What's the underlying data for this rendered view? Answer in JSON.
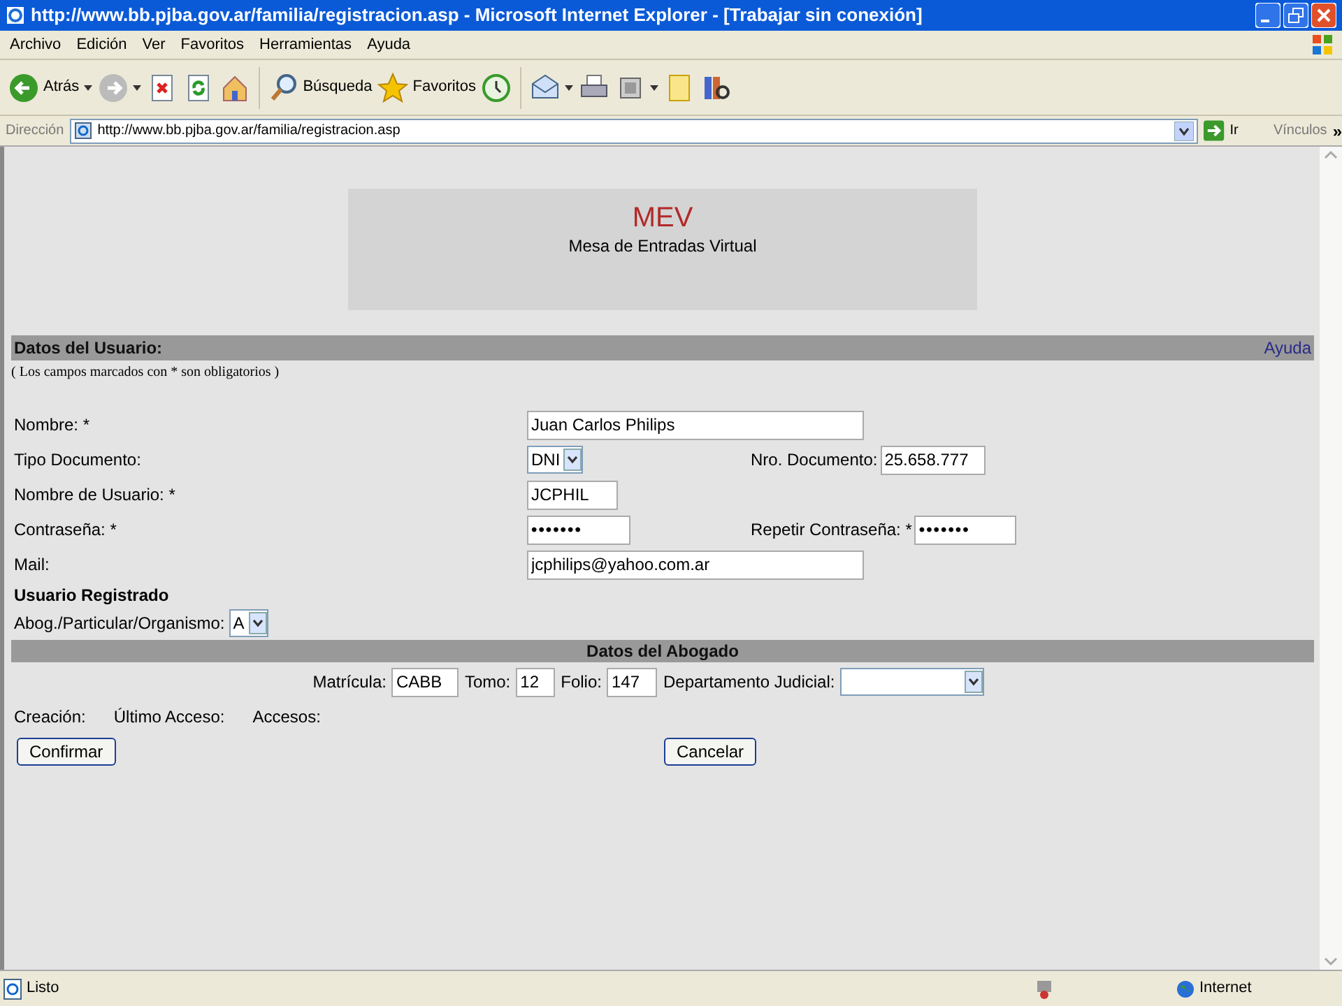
{
  "window": {
    "title": "http://www.bb.pjba.gov.ar/familia/registracion.asp - Microsoft Internet Explorer - [Trabajar sin conexión]"
  },
  "menu": [
    "Archivo",
    "Edición",
    "Ver",
    "Favoritos",
    "Herramientas",
    "Ayuda"
  ],
  "toolbar": [
    {
      "kind": "back",
      "label": "Atrás"
    },
    {
      "kind": "forward"
    },
    {
      "kind": "stop"
    },
    {
      "kind": "refresh"
    },
    {
      "kind": "home"
    },
    {
      "kind": "search",
      "label": "Búsqueda"
    },
    {
      "kind": "favorites",
      "label": "Favoritos"
    },
    {
      "kind": "history"
    },
    {
      "kind": "mail"
    },
    {
      "kind": "print"
    },
    {
      "kind": "edit"
    },
    {
      "kind": "notes"
    },
    {
      "kind": "research"
    }
  ],
  "address": {
    "label": "Dirección",
    "url": "http://www.bb.pjba.gov.ar/familia/registracion.asp",
    "go": "Ir",
    "links": "Vínculos",
    "more": "»"
  },
  "header": {
    "title": "MEV",
    "subtitle": "Mesa de Entradas Virtual"
  },
  "user_section": {
    "title": "Datos del Usuario:",
    "help": "Ayuda",
    "note": "( Los campos marcados con * son obligatorios )"
  },
  "user_fields": [
    {
      "label": "Nombre: *",
      "kind": "text",
      "value": "Juan Carlos Philips"
    },
    {
      "label": "Tipo Documento:",
      "kind": "select",
      "value": "DNI",
      "extra": {
        "label": "Nro. Documento:",
        "kind": "text",
        "value": "25.658.777"
      }
    },
    {
      "label": "Nombre de Usuario: *",
      "kind": "text",
      "value": "JCPHIL"
    },
    {
      "label": "Contraseña: *",
      "kind": "password",
      "value": "•••••••",
      "extra": {
        "label": "Repetir Contraseña: *",
        "kind": "password",
        "value": "•••••••"
      }
    },
    {
      "label": "Mail:",
      "kind": "text",
      "value": "jcphilips@yahoo.com.ar"
    }
  ],
  "registered": {
    "heading": "Usuario Registrado",
    "type_label": "Abog./Particular/Organismo:",
    "type_value": "A"
  },
  "lawyer": {
    "title": "Datos del Abogado",
    "fields": [
      {
        "label": "Matrícula:",
        "kind": "text",
        "value": "CABB"
      },
      {
        "label": "Tomo:",
        "kind": "text",
        "value": "12"
      },
      {
        "label": "Folio:",
        "kind": "text",
        "value": "147"
      },
      {
        "label": "Departamento Judicial:",
        "kind": "select"
      }
    ]
  },
  "info": [
    "Creación:",
    "Último Acceso:",
    "Accesos:"
  ],
  "buttons": [
    "Confirmar",
    "Cancelar"
  ],
  "status_bar": {
    "text": "Listo",
    "zone": "Internet"
  }
}
